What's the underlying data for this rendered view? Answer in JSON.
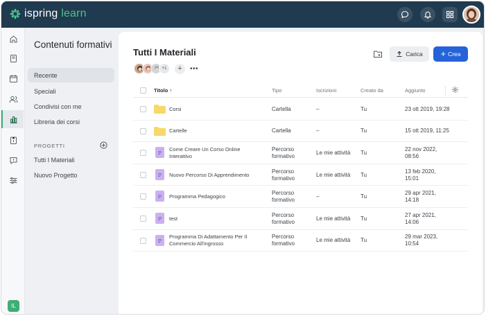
{
  "app": {
    "logo_brand": "ispring",
    "logo_product": "learn"
  },
  "colors": {
    "topbar": "#203a4f",
    "accent_green": "#3fae74",
    "primary_blue": "#2563d9",
    "folder_yellow": "#f7d86b",
    "course_purple": "#c9b2ef"
  },
  "topbar": {
    "icons": [
      "chat-icon",
      "bell-icon",
      "grid-icon"
    ]
  },
  "rail": {
    "badge": "IL",
    "icons": [
      "home-icon",
      "book-icon",
      "calendar-icon",
      "users-icon",
      "chart-icon",
      "clipboard-icon",
      "message-icon",
      "settings-sliders-icon"
    ]
  },
  "subnav": {
    "title": "Contenuti formativi",
    "items": [
      "Recente",
      "Speciali",
      "Condivisi con me",
      "Libreria dei corsi"
    ],
    "section_label": "PROGETTI",
    "projects": [
      "Tutti I Materiali",
      "Nuovo Progetto"
    ]
  },
  "main": {
    "title": "Tutti I Materiali",
    "avatar_count": "+1",
    "upload_label": "Carica",
    "create_label": "Crea",
    "columns": {
      "title": "Titolo",
      "type": "Tipo",
      "enrollments": "Iscrizioni",
      "created_by": "Creato da",
      "updated": "Aggiunto"
    },
    "rows": [
      {
        "kind": "folder",
        "name": "Corsi",
        "type": "Cartella",
        "enrollments": "–",
        "created_by": "Tu",
        "updated": "23 ott 2019, 19:28"
      },
      {
        "kind": "folder",
        "name": "Cartelle",
        "type": "Cartella",
        "enrollments": "–",
        "created_by": "Tu",
        "updated": "15 ott 2019, 11:25"
      },
      {
        "kind": "course",
        "name": "Come Creare Un Corso Online Interattivo",
        "type": "Percorso formativo",
        "enrollments": "Le mie attività",
        "created_by": "Tu",
        "updated": "22 nov 2022, 08:56"
      },
      {
        "kind": "course",
        "name": "Nuovo Percorso Di Apprendimento",
        "type": "Percorso formativo",
        "enrollments": "Le mie attività",
        "created_by": "Tu",
        "updated": "13 feb 2020, 15:01"
      },
      {
        "kind": "course",
        "name": "Programma Pedagogico",
        "type": "Percorso formativo",
        "enrollments": "–",
        "created_by": "Tu",
        "updated": "29 apr 2021, 14:18"
      },
      {
        "kind": "course",
        "name": "test",
        "type": "Percorso formativo",
        "enrollments": "Le mie attività",
        "created_by": "Tu",
        "updated": "27 apr 2021, 14:06"
      },
      {
        "kind": "course",
        "name": "Programma Di Adattamento Per Il Commercio All'ingrosso",
        "type": "Percorso formativo",
        "enrollments": "Le mie attività",
        "created_by": "Tu",
        "updated": "29 mar 2023, 10:54"
      }
    ]
  }
}
